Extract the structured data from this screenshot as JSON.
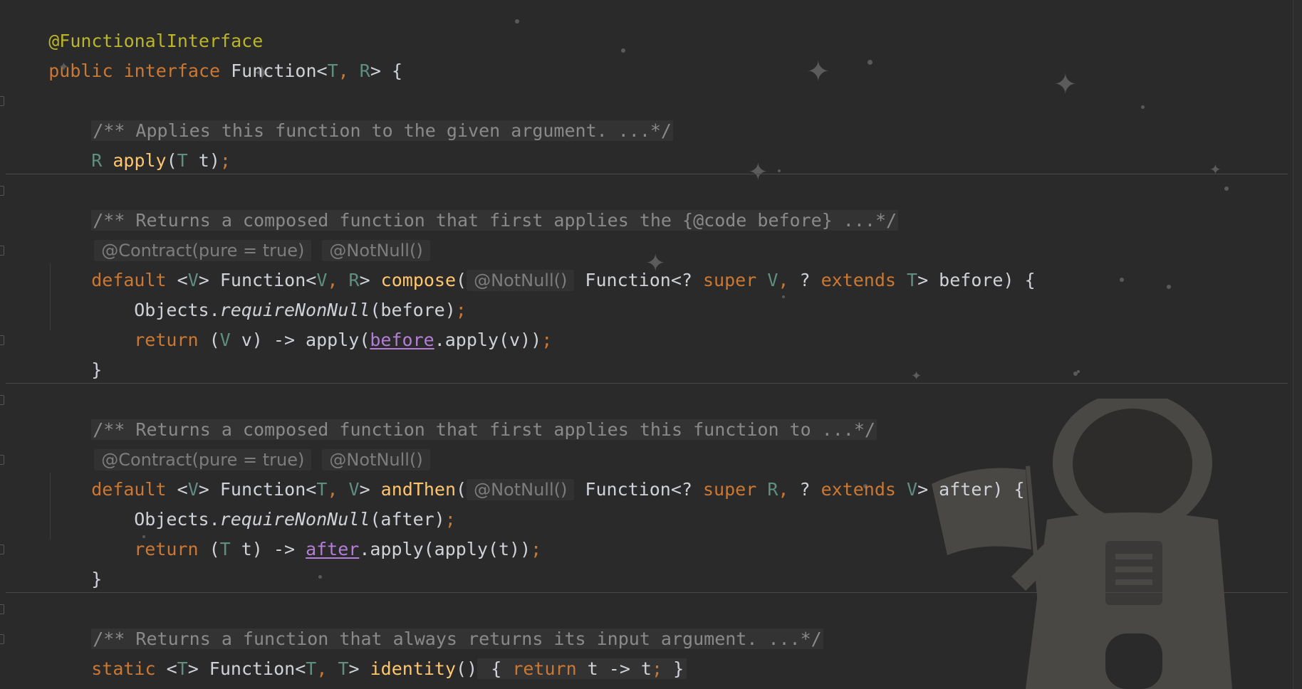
{
  "editor": {
    "lines": {
      "l1": {
        "annotation": "@FunctionalInterface"
      },
      "l2": {
        "public": "public",
        "interface": "interface",
        "name": "Function",
        "lt": "<",
        "t": "T",
        "comma": ",",
        "r": "R",
        "gt": ">",
        "brace": " {"
      },
      "l3": {
        "comment": "/** Applies this function to the given argument. ...*/"
      },
      "l4": {
        "r": "R",
        "method": "apply",
        "open": "(",
        "t": "T",
        "param": " t",
        "close": ")",
        "semi": ";"
      },
      "l5": {
        "comment": "/** Returns a composed function that first applies the {@code before} ...*/"
      },
      "l6": {
        "contract": "@Contract(pure = true)",
        "notnull": "@NotNull()"
      },
      "l7": {
        "default": "default",
        "tparams_open": " <",
        "v": "V",
        "tparams_close": "> Function<",
        "v2": "V",
        "comma": ",",
        "r": " R",
        "gt": "> ",
        "method": "compose",
        "open": "(",
        "notnull": "@NotNull()",
        "fn": " Function<? ",
        "super": "super",
        "v3": " V",
        "comma2": ",",
        "q": " ? ",
        "extends": "extends",
        "t": " T",
        "tail": "> before) {"
      },
      "l8": {
        "objects": "Objects.",
        "require": "requireNonNull",
        "args": "(before)",
        "semi": ";"
      },
      "l9": {
        "return": "return",
        "open": " (",
        "v": "V",
        "rest": " v) -> apply(",
        "field": "before",
        "tail": ".apply(v))",
        "semi": ";"
      },
      "l10": {
        "brace": "}"
      },
      "l11": {
        "comment": "/** Returns a composed function that first applies this function to ...*/"
      },
      "l12": {
        "contract": "@Contract(pure = true)",
        "notnull": "@NotNull()"
      },
      "l13": {
        "default": "default",
        "tparams_open": " <",
        "v": "V",
        "tparams_close": "> Function<",
        "t": "T",
        "comma": ",",
        "v2": " V",
        "gt": "> ",
        "method": "andThen",
        "open": "(",
        "notnull": "@NotNull()",
        "fn": " Function<? ",
        "super": "super",
        "r": " R",
        "comma2": ",",
        "q": " ? ",
        "extends": "extends",
        "v3": " V",
        "tail": "> after) {"
      },
      "l14": {
        "objects": "Objects.",
        "require": "requireNonNull",
        "args": "(after)",
        "semi": ";"
      },
      "l15": {
        "return": "return",
        "open": " (",
        "t": "T",
        "rest": " t) -> ",
        "field": "after",
        "tail": ".apply(apply(t))",
        "semi": ";"
      },
      "l16": {
        "brace": "}"
      },
      "l17": {
        "comment": "/** Returns a function that always returns its input argument. ...*/"
      },
      "l18": {
        "static": "static",
        "open": " <",
        "t": "T",
        "mid": "> Function<",
        "t2": "T",
        "comma": ",",
        "t3": " T",
        "gt": "> ",
        "method": "identity",
        "parens": "()",
        "body_open": " { ",
        "return": "return",
        "expr": " t -> t",
        "semi": ";",
        "body_close": " }"
      },
      "l19": {
        "brace": "}"
      }
    }
  }
}
